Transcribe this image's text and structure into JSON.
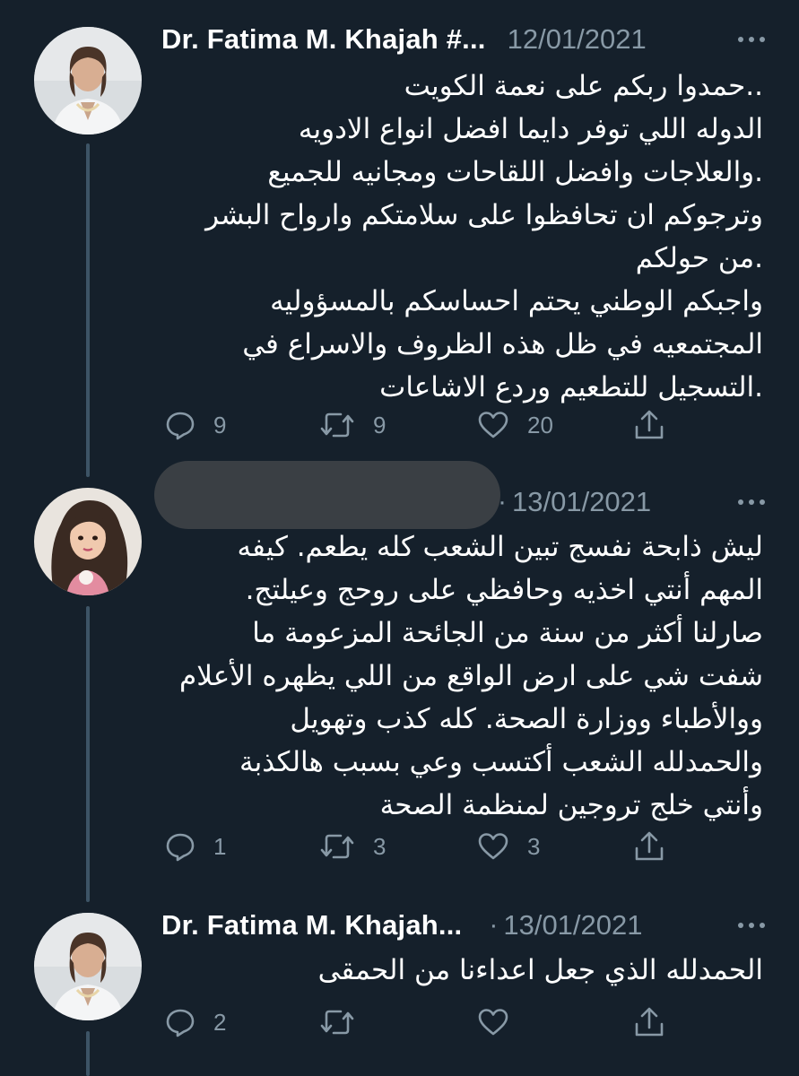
{
  "colors": {
    "background": "#15202b",
    "text": "#ffffff",
    "secondary": "#8899a6",
    "thread_line": "#3d5466"
  },
  "tweets": [
    {
      "author": "Dr. Fatima M. Khajah #...",
      "separator": "",
      "date": "12/01/2021",
      "lines": [
        "..حمدوا ربكم على نعمة الكويت",
        "الدوله اللي توفر دايما افضل انواع الادويه",
        ".والعلاجات وافضل اللقاحات ومجانيه للجميع",
        "وترجوكم ان تحافظوا على سلامتكم وارواح البشر",
        ".من حولكم",
        "واجبكم الوطني يحتم احساسكم بالمسؤوليه",
        "المجتمعيه في ظل هذه الظروف والاسراع في",
        ".التسجيل للتطعيم وردع الاشاعات"
      ],
      "replies": "9",
      "retweets": "9",
      "likes": "20",
      "icons": [
        "reply-icon",
        "retweet-icon",
        "like-icon",
        "share-icon"
      ]
    },
    {
      "author": "",
      "separator": "·",
      "date": "13/01/2021",
      "lines": [
        "ليش ذابحة نفسج تبين الشعب كله يطعم. كيفه",
        "المهم أنتي اخذيه وحافظي على روحج وعيلتج.",
        "صارلنا أكثر من سنة من الجائحة المزعومة ما",
        "شفت شي على ارض الواقع من اللي يظهره الأعلام",
        "ووالأطباء ووزارة الصحة. كله كذب وتهويل",
        "والحمدلله الشعب أكتسب وعي بسبب هالكذبة",
        "وأنتي خلج تروجين لمنظمة الصحة"
      ],
      "replies": "1",
      "retweets": "3",
      "likes": "3",
      "icons": [
        "reply-icon",
        "retweet-icon",
        "like-icon",
        "share-icon"
      ]
    },
    {
      "author": "Dr. Fatima M. Khajah...",
      "separator": "·",
      "date": "13/01/2021",
      "lines": [
        "الحمدلله الذي جعل اعداءنا من الحمقى"
      ],
      "replies": "2",
      "retweets": "",
      "likes": "",
      "icons": [
        "reply-icon",
        "retweet-icon",
        "like-icon",
        "share-icon"
      ]
    }
  ]
}
